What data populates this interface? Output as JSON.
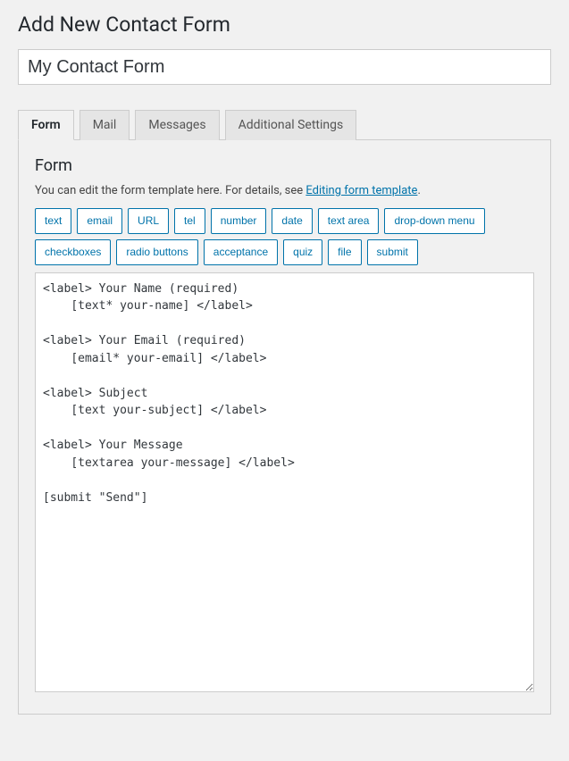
{
  "page": {
    "title": "Add New Contact Form"
  },
  "form_title": {
    "value": "My Contact Form"
  },
  "tabs": [
    {
      "label": "Form",
      "active": true
    },
    {
      "label": "Mail",
      "active": false
    },
    {
      "label": "Messages",
      "active": false
    },
    {
      "label": "Additional Settings",
      "active": false
    }
  ],
  "panel": {
    "heading": "Form",
    "help_prefix": "You can edit the form template here. For details, see ",
    "help_link_text": "Editing form template",
    "help_suffix": "."
  },
  "tag_buttons": [
    "text",
    "email",
    "URL",
    "tel",
    "number",
    "date",
    "text area",
    "drop-down menu",
    "checkboxes",
    "radio buttons",
    "acceptance",
    "quiz",
    "file",
    "submit"
  ],
  "template": "<label> Your Name (required)\n    [text* your-name] </label>\n\n<label> Your Email (required)\n    [email* your-email] </label>\n\n<label> Subject\n    [text your-subject] </label>\n\n<label> Your Message\n    [textarea your-message] </label>\n\n[submit \"Send\"]"
}
